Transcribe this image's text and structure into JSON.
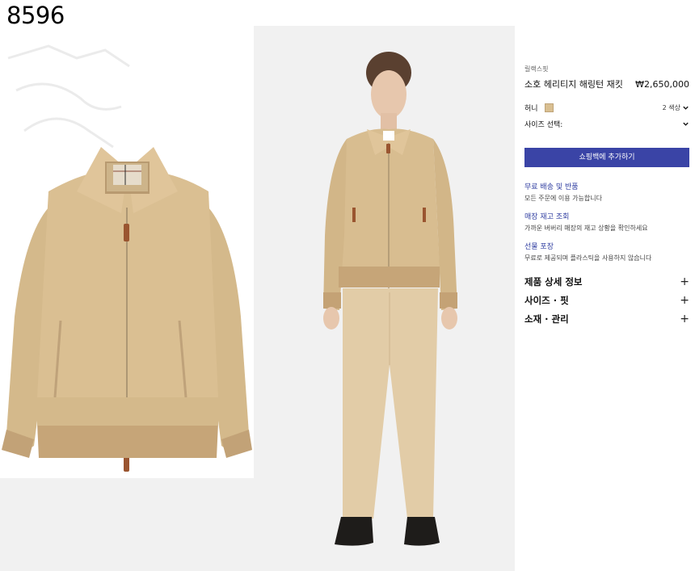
{
  "code_label": "8596",
  "product": {
    "category": "릴랙스핏",
    "name": "소호 헤리티지 해링턴 재킷",
    "price": "₩2,650,000"
  },
  "color": {
    "name": "허니",
    "swatch": "#d9bf91",
    "count_label": "2 색상"
  },
  "size": {
    "label": "사이즈 선택:"
  },
  "add_to_bag": "쇼핑백에 추가하기",
  "services": [
    {
      "title": "무료 배송 및 반품",
      "desc": "모든 주문에 이용 가능합니다"
    },
    {
      "title": "매장 재고 조회",
      "desc": "가까운 버버리 매장의 재고 상황을 확인하세요"
    },
    {
      "title": "선물 포장",
      "desc": "무료로 제공되며 플라스틱을 사용하지 않습니다"
    }
  ],
  "accordion": [
    {
      "label": "제품 상세 정보",
      "icon": "plus-icon"
    },
    {
      "label": "사이즈 · 핏",
      "icon": "plus-icon"
    },
    {
      "label": "소재 · 관리",
      "icon": "plus-icon"
    }
  ],
  "colors": {
    "accent": "#3a44a6",
    "link": "#2f3da0",
    "jacket": "#d8bd90",
    "rib": "#c9a87a"
  }
}
